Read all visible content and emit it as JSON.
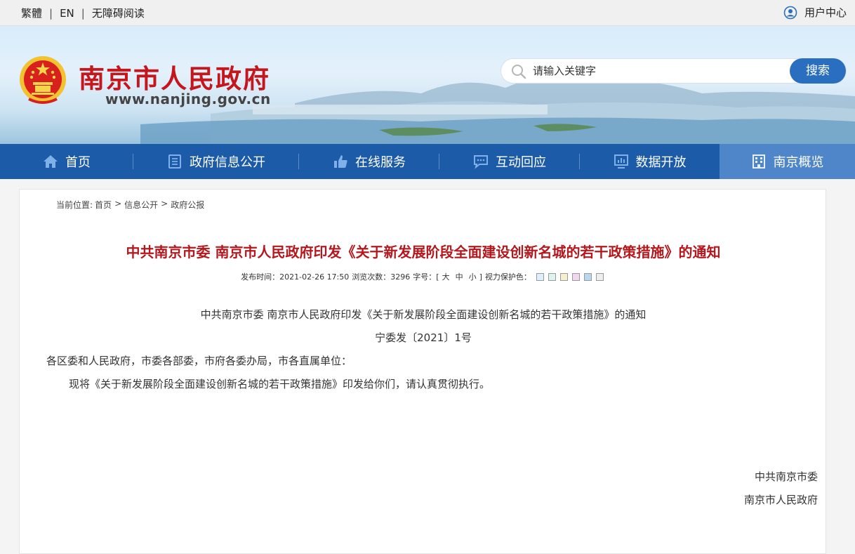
{
  "topbar": {
    "lang_traditional": "繁體",
    "lang_en": "EN",
    "accessibility": "无障碍阅读",
    "separator": "|",
    "user_center": "用户中心"
  },
  "header": {
    "site_title": "南京市人民政府",
    "site_url": "www.nanjing.gov.cn",
    "search_placeholder": "请输入关键字",
    "search_button": "搜索"
  },
  "nav": {
    "items": [
      {
        "label": "首页",
        "icon": "home-icon"
      },
      {
        "label": "政府信息公开",
        "icon": "document-icon"
      },
      {
        "label": "在线服务",
        "icon": "thumbs-up-icon"
      },
      {
        "label": "互动回应",
        "icon": "chat-icon"
      },
      {
        "label": "数据开放",
        "icon": "chart-icon"
      },
      {
        "label": "南京概览",
        "icon": "building-icon"
      }
    ],
    "active_index": 5
  },
  "breadcrumb": {
    "prefix": "当前位置:",
    "items": [
      "首页",
      "信息公开",
      "政府公报"
    ],
    "separator": ">"
  },
  "article": {
    "title": "中共南京市委  南京市人民政府印发《关于新发展阶段全面建设创新名城的若干政策措施》的通知",
    "meta_publish": "发布时间：2021-02-26 17:50",
    "meta_views": "浏览次数：3296",
    "meta_font_label": "字号：[",
    "meta_font_large": "大",
    "meta_font_medium": "中",
    "meta_font_small": "小",
    "meta_font_close": "]",
    "meta_eye_label": "视力保护色：",
    "eye_colors": [
      "#ddeeff",
      "#ddf4ee",
      "#f6f0cc",
      "#f4d6f2",
      "#b7d6f0",
      "#eeeeee"
    ],
    "heading": "中共南京市委 南京市人民政府印发《关于新发展阶段全面建设创新名城的若干政策措施》的通知",
    "doc_number": "宁委发〔2021〕1号",
    "salutation": "各区委和人民政府，市委各部委，市府各委办局，市各直属单位：",
    "body": "现将《关于新发展阶段全面建设创新名城的若干政策措施》印发给你们，请认真贯彻执行。",
    "sign_1": "中共南京市委",
    "sign_2": "南京市人民政府"
  },
  "colors": {
    "brand_red": "#c4161c",
    "nav_blue": "#1c5ba8",
    "nav_active": "#4f86c9",
    "button_blue": "#2a6fbf"
  }
}
